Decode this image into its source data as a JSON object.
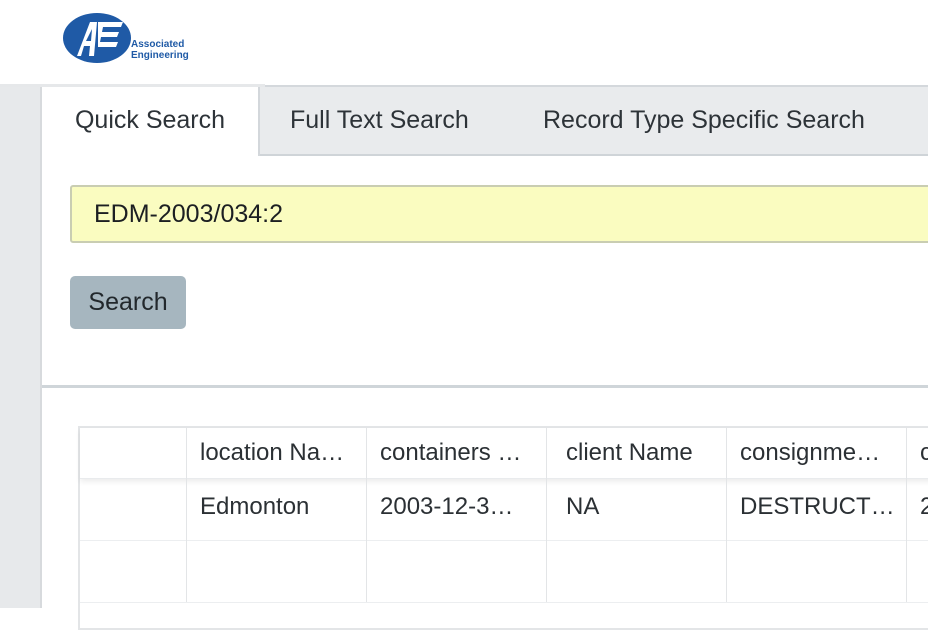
{
  "header": {
    "logo": {
      "mark_text": "AE",
      "line1": "Associated",
      "line2": "Engineering",
      "brand_color": "#1f5aa6"
    }
  },
  "tabs": [
    {
      "label": "Quick Search",
      "active": true
    },
    {
      "label": "Full Text Search",
      "active": false
    },
    {
      "label": "Record Type Specific Search",
      "active": false
    }
  ],
  "search": {
    "value": "EDM-2003/034:2",
    "input_bg": "#fafcc0",
    "button_label": "Search",
    "button_color": "#a6b6bf"
  },
  "results": {
    "columns": [
      "",
      "location Na…",
      "containers …",
      "client Name",
      "consignme…",
      "c"
    ],
    "rows": [
      [
        "",
        "Edmonton",
        "2003-12-3…",
        "NA",
        "DESTRUCT…",
        "2"
      ],
      [
        "",
        "",
        "",
        "",
        "",
        ""
      ]
    ]
  }
}
